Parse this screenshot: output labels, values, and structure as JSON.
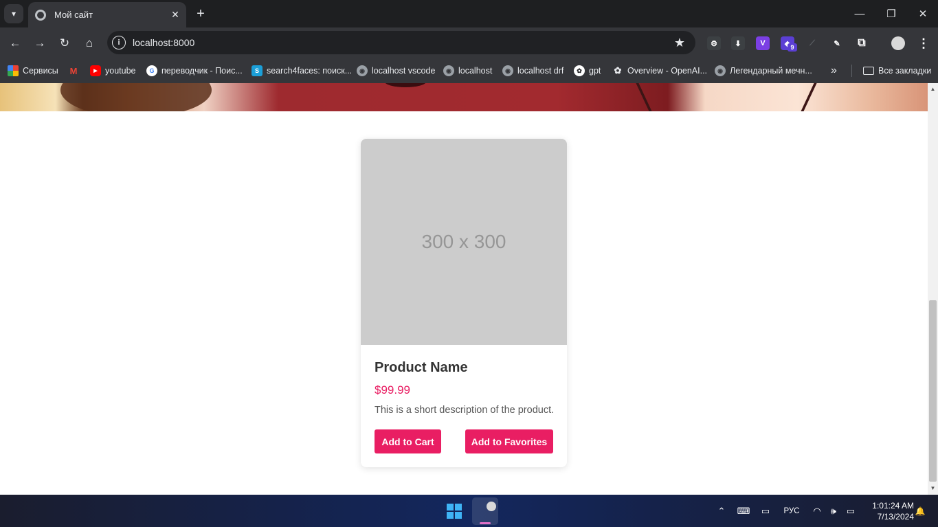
{
  "browser": {
    "tab": {
      "title": "Мой сайт",
      "close_glyph": "✕"
    },
    "new_tab_glyph": "+",
    "window_controls": {
      "minimize": "—",
      "restore": "❐",
      "close": "✕"
    },
    "nav": {
      "back": "←",
      "forward": "→",
      "reload": "↻",
      "home": "⌂"
    },
    "omnibox": {
      "url": "localhost:8000",
      "info_glyph": "i",
      "star_glyph": "★"
    },
    "extensions": [
      {
        "name": "extension-icon-1",
        "glyph": "⚙",
        "color": "#3c4043"
      },
      {
        "name": "extension-icon-2",
        "glyph": "⬇",
        "color": "#3c4043"
      },
      {
        "name": "extension-icon-3",
        "glyph": "V",
        "color": "#7b3fe4"
      },
      {
        "name": "extension-icon-4",
        "glyph": "◆",
        "color": "#5b3fd4",
        "badge": "9"
      },
      {
        "name": "extension-icon-5",
        "glyph": "⟋",
        "color": "#3c4043"
      },
      {
        "name": "extension-icon-6",
        "glyph": "✎",
        "color": "#3c4043"
      }
    ],
    "puzzle_glyph": "⧉",
    "menu_glyph": "⋮",
    "bookmarks": [
      {
        "label": "Сервисы",
        "icon": "apps-grid-icon",
        "color": "#ea4335"
      },
      {
        "label": "",
        "icon": "gmail-icon",
        "color": "#ea4335",
        "glyph": "M"
      },
      {
        "label": "youtube",
        "icon": "youtube-icon",
        "color": "#ff0000",
        "glyph": "▶"
      },
      {
        "label": "переводчик - Поис...",
        "icon": "google-icon",
        "color": "#4285f4",
        "glyph": "G"
      },
      {
        "label": "search4faces: поиск...",
        "icon": "s-icon",
        "color": "#1b9fd8",
        "glyph": "S"
      },
      {
        "label": "localhost vscode",
        "icon": "globe-icon",
        "color": "#9aa0a6",
        "glyph": "◉"
      },
      {
        "label": "localhost",
        "icon": "globe-icon",
        "color": "#9aa0a6",
        "glyph": "◉"
      },
      {
        "label": "localhost drf",
        "icon": "globe-icon",
        "color": "#9aa0a6",
        "glyph": "◉"
      },
      {
        "label": "gpt",
        "icon": "openai-icon",
        "color": "#e8eaed",
        "glyph": "✿"
      },
      {
        "label": "Overview - OpenAI...",
        "icon": "openai-icon",
        "color": "#e8eaed",
        "glyph": "✿"
      },
      {
        "label": "Легендарный мечн...",
        "icon": "globe-icon",
        "color": "#9aa0a6",
        "glyph": "◉"
      }
    ],
    "bookmarks_more": "»",
    "all_bookmarks": "Все закладки"
  },
  "page": {
    "product": {
      "image_placeholder": "300 x 300",
      "name": "Product Name",
      "price": "$99.99",
      "description": "This is a short description of the product.",
      "add_to_cart": "Add to Cart",
      "add_to_favorites": "Add to Favorites",
      "accent_color": "#e91e63"
    }
  },
  "taskbar": {
    "language": "РУС",
    "time": "1:01:24 AM",
    "date": "7/13/2024",
    "tray": {
      "chevron": "⌃",
      "keyboard": "⌨",
      "display": "▭",
      "wifi": "◠",
      "volume": "🕪",
      "battery": "▭",
      "bell": "🔔"
    }
  }
}
